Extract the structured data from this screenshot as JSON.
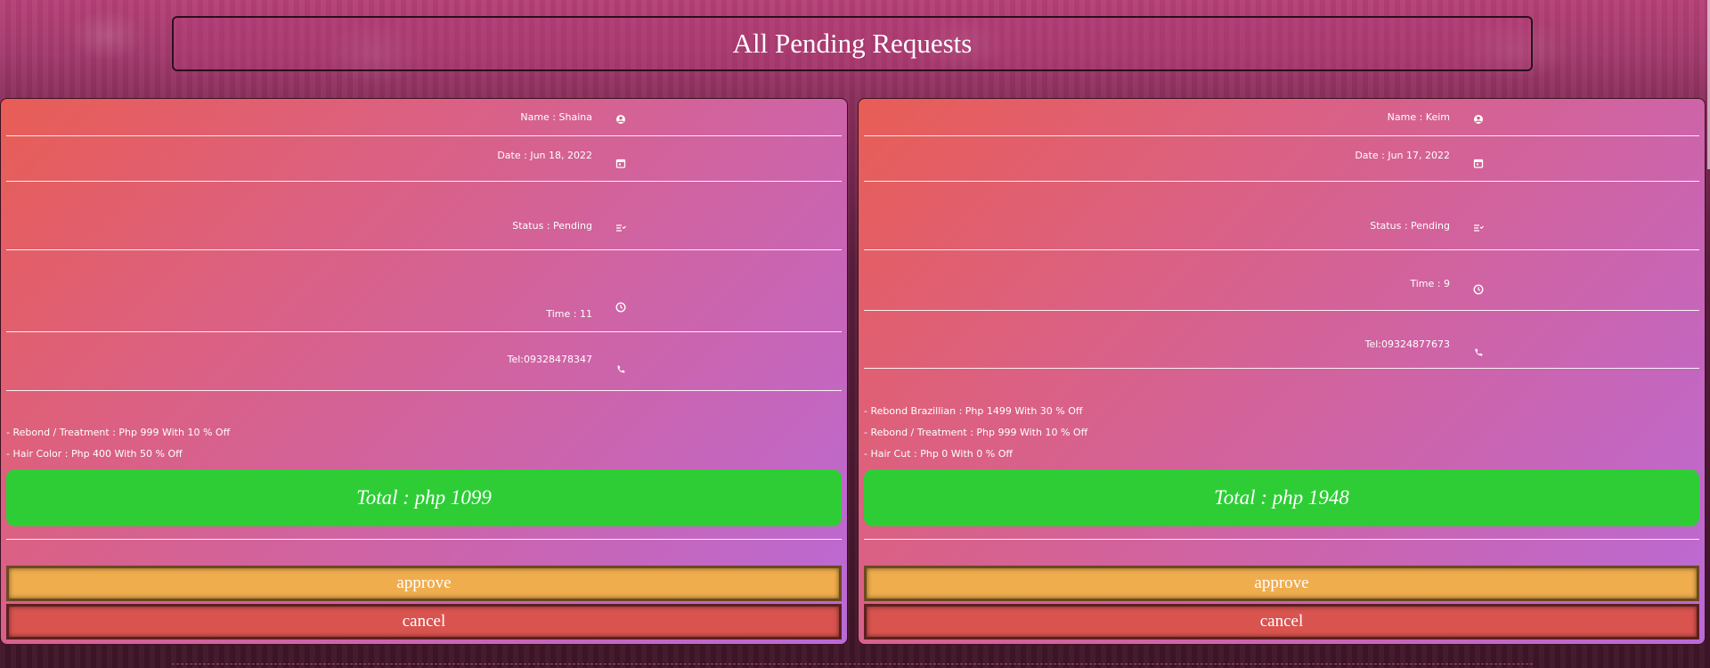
{
  "title": "All Pending Requests",
  "requests": [
    {
      "name": "Name : Shaina",
      "date": "Date : Jun 18, 2022",
      "status": "Status : Pending",
      "time": "Time : 11",
      "tel": "Tel:09328478347",
      "services": [
        "- Rebond / Treatment : Php 999 With 10 % Off",
        "- Hair Color : Php 400 With 50 % Off"
      ],
      "total": "Total : php 1099",
      "approve_label": "approve",
      "cancel_label": "cancel"
    },
    {
      "name": "Name : Keim",
      "date": "Date : Jun 17, 2022",
      "status": "Status : Pending",
      "time": "Time : 9",
      "tel": "Tel:09324877673",
      "services": [
        "- Rebond Brazillian : Php 1499 With 30 % Off",
        "- Rebond / Treatment : Php 999 With 10 % Off",
        "- Hair Cut : Php 0 With 0 % Off"
      ],
      "total": "Total : php 1948",
      "approve_label": "approve",
      "cancel_label": "cancel"
    }
  ],
  "colors": {
    "total": "#2ecd36",
    "approve": "#f0ad4e",
    "cancel": "#d9534f"
  },
  "icons": {
    "name": "user-icon",
    "date": "calendar-icon",
    "status": "list-check-icon",
    "time": "clock-icon",
    "tel": "phone-icon"
  }
}
